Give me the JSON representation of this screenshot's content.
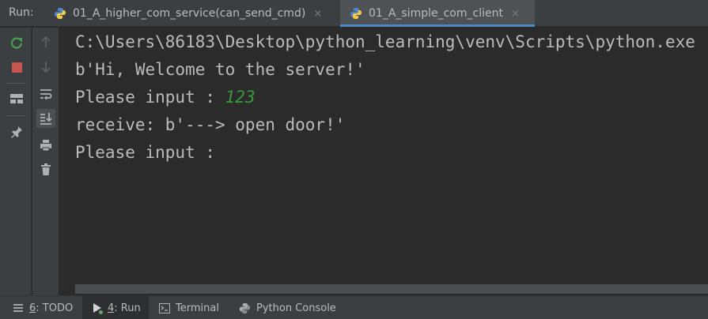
{
  "run_panel": {
    "label": "Run:",
    "tabs": [
      {
        "title": "01_A_higher_com_service(can_send_cmd)",
        "close": "×",
        "active": false
      },
      {
        "title": "01_A_simple_com_client",
        "close": "×",
        "active": true
      }
    ]
  },
  "console": {
    "lines": [
      {
        "text": "C:\\Users\\86183\\Desktop\\python_learning\\venv\\Scripts\\python.exe"
      },
      {
        "text": "b'Hi, Welcome to the server!'"
      },
      {
        "prompt": "Please input : ",
        "input": "123"
      },
      {
        "text": "receive: b'---> open door!'"
      },
      {
        "text": "Please input :"
      }
    ],
    "input_color": "#3a9a3a"
  },
  "toolbar_left": {
    "icons": [
      "rerun-icon",
      "stop-icon",
      "layout-icon",
      "pin-icon"
    ]
  },
  "toolbar_right": {
    "icons": [
      "up-arrow-icon",
      "down-arrow-icon",
      "soft-wrap-icon",
      "scroll-to-end-icon",
      "print-icon",
      "trash-icon"
    ]
  },
  "bottom_tabs": [
    {
      "mnemonic": "6",
      "label": ": TODO",
      "icon": "todo-icon",
      "active": false
    },
    {
      "mnemonic": "4",
      "label": ": Run",
      "icon": "run-icon",
      "active": true
    },
    {
      "label": "Terminal",
      "icon": "terminal-icon",
      "active": false
    },
    {
      "label": "Python Console",
      "icon": "python-console-icon",
      "active": false
    }
  ],
  "colors": {
    "background": "#2b2b2b",
    "panel": "#3c3f41",
    "accent": "#4a88c7",
    "rerun": "#499c54",
    "stop": "#c75450"
  }
}
